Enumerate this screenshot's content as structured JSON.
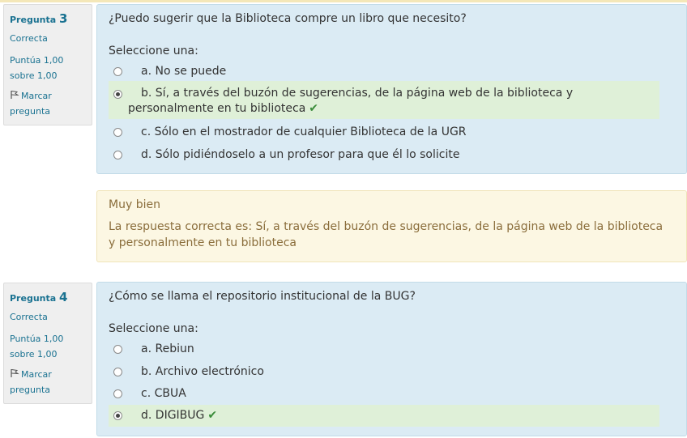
{
  "questions": [
    {
      "label": "Pregunta",
      "number": "3",
      "state": "Correcta",
      "grade_line1": "Puntúa 1,00",
      "grade_line2": "sobre 1,00",
      "flag_line1": "Marcar",
      "flag_line2": "pregunta",
      "text": "¿Puedo sugerir que la Biblioteca compre un libro que necesito?",
      "prompt": "Seleccione una:",
      "answers": [
        {
          "label": "a. No se puede",
          "selected": false,
          "correct": false
        },
        {
          "label": "b. Sí, a través del buzón de sugerencias, de la página web de la biblioteca y personalmente en tu biblioteca",
          "selected": true,
          "correct": true
        },
        {
          "label": "c. Sólo en el mostrador de cualquier Biblioteca de la UGR",
          "selected": false,
          "correct": false
        },
        {
          "label": "d. Sólo pidiéndoselo a un profesor para que él lo solicite",
          "selected": false,
          "correct": false
        }
      ],
      "feedback": "Muy bien",
      "right_answer": "La respuesta correcta es: Sí, a través del buzón de sugerencias, de la página web de la biblioteca y personalmente en tu biblioteca"
    },
    {
      "label": "Pregunta",
      "number": "4",
      "state": "Correcta",
      "grade_line1": "Puntúa 1,00",
      "grade_line2": "sobre 1,00",
      "flag_line1": "Marcar",
      "flag_line2": "pregunta",
      "text": "¿Cómo se llama el repositorio institucional de la BUG?",
      "prompt": "Seleccione una:",
      "answers": [
        {
          "label": "a. Rebiun",
          "selected": false,
          "correct": false
        },
        {
          "label": "b. Archivo electrónico",
          "selected": false,
          "correct": false
        },
        {
          "label": "c. CBUA",
          "selected": false,
          "correct": false
        },
        {
          "label": "d. DIGIBUG",
          "selected": true,
          "correct": true
        }
      ]
    }
  ],
  "colors": {
    "info_text": "#1a7291",
    "formulation_bg": "#dbebf4",
    "correct_bg": "#dff0d8",
    "outcome_bg": "#fcf7e3",
    "outcome_text": "#8a6d3b",
    "check": "#3a8c3a"
  },
  "icons": {
    "flag": "flag-icon",
    "correct": "check-icon"
  }
}
